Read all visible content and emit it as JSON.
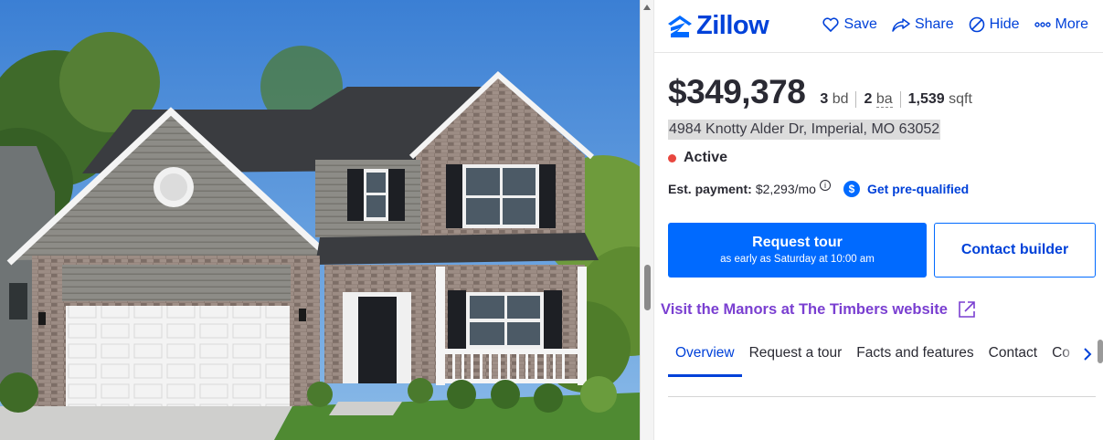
{
  "brand": {
    "logo_text": "Zillow",
    "color": "#0041d9",
    "accent": "#006aff"
  },
  "header_actions": [
    {
      "label": "Save",
      "icon": "heart-icon"
    },
    {
      "label": "Share",
      "icon": "share-icon"
    },
    {
      "label": "Hide",
      "icon": "hide-icon"
    },
    {
      "label": "More",
      "icon": "more-icon"
    }
  ],
  "listing": {
    "price": "$349,378",
    "beds_value": "3",
    "beds_unit": "bd",
    "baths_value": "2",
    "baths_unit": "ba",
    "sqft_value": "1,539",
    "sqft_unit": "sqft",
    "address": "4984 Knotty Alder Dr, Imperial, MO 63052",
    "status": "Active",
    "status_color": "#e8473f",
    "payment_label": "Est. payment:",
    "payment_value": "$2,293/mo",
    "prequal_label": "Get pre-qualified"
  },
  "buttons": {
    "request_tour": "Request tour",
    "request_tour_sub": "as early as Saturday at 10:00 am",
    "contact_builder": "Contact builder"
  },
  "visit_link": "Visit the Manors at The Timbers website",
  "tabs": [
    {
      "label": "Overview",
      "active": true
    },
    {
      "label": "Request a tour",
      "active": false
    },
    {
      "label": "Facts and features",
      "active": false
    },
    {
      "label": "Contact",
      "active": false
    },
    {
      "label": "Co",
      "active": false
    }
  ]
}
